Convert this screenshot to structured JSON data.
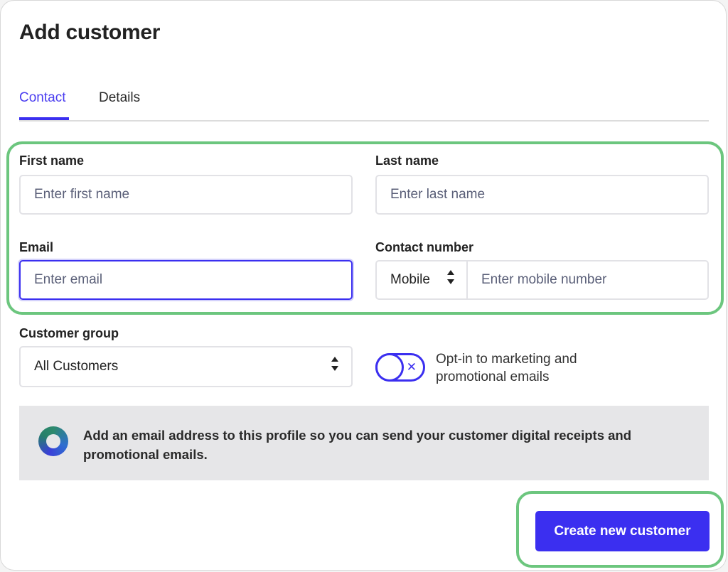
{
  "dialog": {
    "title": "Add customer"
  },
  "tabs": [
    {
      "label": "Contact",
      "active": true
    },
    {
      "label": "Details",
      "active": false
    }
  ],
  "form": {
    "first_name": {
      "label": "First name",
      "placeholder": "Enter first name",
      "value": ""
    },
    "last_name": {
      "label": "Last name",
      "placeholder": "Enter last name",
      "value": ""
    },
    "email": {
      "label": "Email",
      "placeholder": "Enter email",
      "value": "",
      "focused": true
    },
    "contact_number": {
      "label": "Contact number",
      "type_selected": "Mobile",
      "placeholder": "Enter mobile number",
      "value": ""
    },
    "customer_group": {
      "label": "Customer group",
      "selected": "All Customers"
    },
    "opt_in": {
      "label": "Opt-in to marketing and promotional emails",
      "enabled": false
    }
  },
  "notice": {
    "text": "Add an email address to this profile so you can send your customer digital receipts and promotional emails."
  },
  "actions": {
    "create_label": "Create new customer"
  },
  "colors": {
    "accent": "#3b2ff0",
    "highlight": "#6cc67e",
    "notice_bg": "#e6e6e8"
  },
  "icons": {
    "stepper": "up-down-arrows-icon",
    "toggle": "close-icon",
    "notice": "ring-icon"
  }
}
